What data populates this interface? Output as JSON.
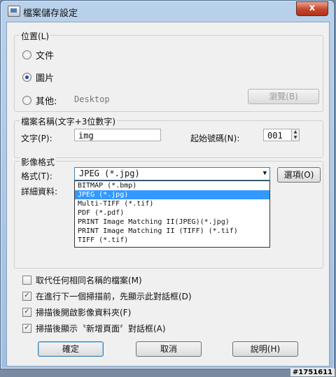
{
  "window": {
    "title": "檔案儲存設定",
    "close": "x"
  },
  "location": {
    "legend": "位置(L)",
    "options": [
      {
        "label": "文件",
        "selected": false
      },
      {
        "label": "圖片",
        "selected": true
      },
      {
        "label": "其他:",
        "selected": false
      }
    ],
    "other_path": "Desktop",
    "browse": "瀏覽(B)"
  },
  "filename": {
    "legend": "檔案名稱(文字+3位數字)",
    "text_label": "文字(P):",
    "text_value": "img",
    "start_label": "起始號碼(N):",
    "start_value": "001"
  },
  "format": {
    "legend": "影像格式",
    "format_label": "格式(T):",
    "selected": "JPEG (*.jpg)",
    "options_button": "選項(O)",
    "details_label": "詳細資料:",
    "dropdown": [
      "BITMAP (*.bmp)",
      "JPEG (*.jpg)",
      "Multi-TIFF (*.tif)",
      "PDF (*.pdf)",
      "PRINT Image Matching II(JPEG)(*.jpg)",
      "PRINT Image Matching II (TIFF) (*.tif)",
      "TIFF (*.tif)"
    ],
    "highlighted_index": 1
  },
  "checks": [
    {
      "label": "取代任何相同名稱的檔案(M)",
      "checked": false
    },
    {
      "label": "在進行下一個掃描前，先顯示此對話框(D)",
      "checked": true
    },
    {
      "label": "掃描後開啟影像資料夾(F)",
      "checked": true
    },
    {
      "label": "掃描後顯示〝新增頁面〞對話框(A)",
      "checked": true
    }
  ],
  "buttons": {
    "ok": "確定",
    "cancel": "取消",
    "help": "說明(H)"
  },
  "watermark": "#1751611"
}
